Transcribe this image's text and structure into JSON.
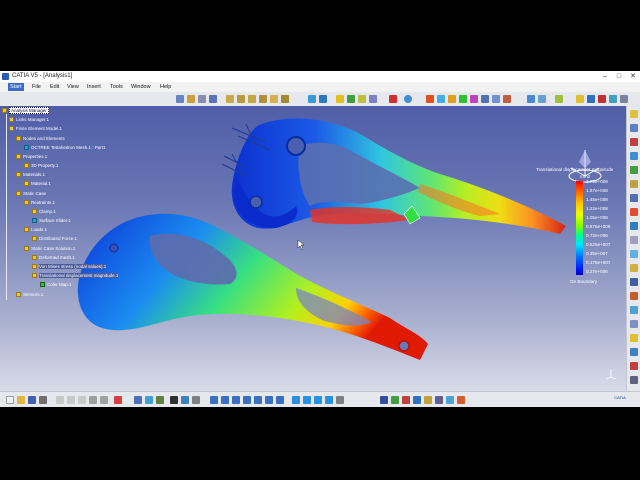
{
  "window": {
    "title": "CATIA V5 - [Analysis1]",
    "controls": [
      "–",
      "□",
      "✕"
    ]
  },
  "menu": {
    "items": [
      "Start",
      "File",
      "Edit",
      "View",
      "Insert",
      "Tools",
      "Window",
      "Help"
    ],
    "active_index": 0
  },
  "tree": {
    "nodes": [
      {
        "label": "Analysis Manager",
        "indent": 0,
        "selected": true
      },
      {
        "label": "Links Manager.1",
        "indent": 1
      },
      {
        "label": "Finite Element Model.1",
        "indent": 1
      },
      {
        "label": "Nodes and Elements",
        "indent": 2
      },
      {
        "label": "OCTREE Tetrahedron Mesh.1 : Part1",
        "indent": 3
      },
      {
        "label": "Properties.1",
        "indent": 2
      },
      {
        "label": "3D Property.1",
        "indent": 3
      },
      {
        "label": "Materials.1",
        "indent": 2
      },
      {
        "label": "Material.1",
        "indent": 3
      },
      {
        "label": "Static Case",
        "indent": 2
      },
      {
        "label": "Restraints.1",
        "indent": 3
      },
      {
        "label": "Clamp.1",
        "indent": 4
      },
      {
        "label": "Surface Slider.1",
        "indent": 4
      },
      {
        "label": "Loads.1",
        "indent": 3
      },
      {
        "label": "Distributed Force.1",
        "indent": 4
      },
      {
        "label": "Static Case Solution.1",
        "indent": 3
      },
      {
        "label": "Deformed mesh.1",
        "indent": 4
      },
      {
        "label": "Von Mises stress (nodal values).1",
        "indent": 4
      },
      {
        "label": "Translational displacement magnitude.1",
        "indent": 4
      },
      {
        "label": "Color Map.1",
        "indent": 5
      },
      {
        "label": "Sensors.1",
        "indent": 2
      }
    ]
  },
  "legend": {
    "title": "Translational displacement magnitude",
    "unit": "mm2",
    "values": [
      "1.75e+008",
      "1.57e+008",
      "1.45e+008",
      "1.22e+008",
      "1.05e+008",
      "0.875e+006",
      "0.73e+008",
      "0.525e+007",
      "0.35e+007",
      "0.175e+007",
      "0.27e+006"
    ],
    "footer": "On Boundary"
  },
  "status": {
    "logo": "CATIA"
  },
  "colors": {
    "menu_active": "#3a6bc7",
    "viewport_top": "#4f5ea8",
    "viewport_bottom": "#d8dbe8"
  }
}
